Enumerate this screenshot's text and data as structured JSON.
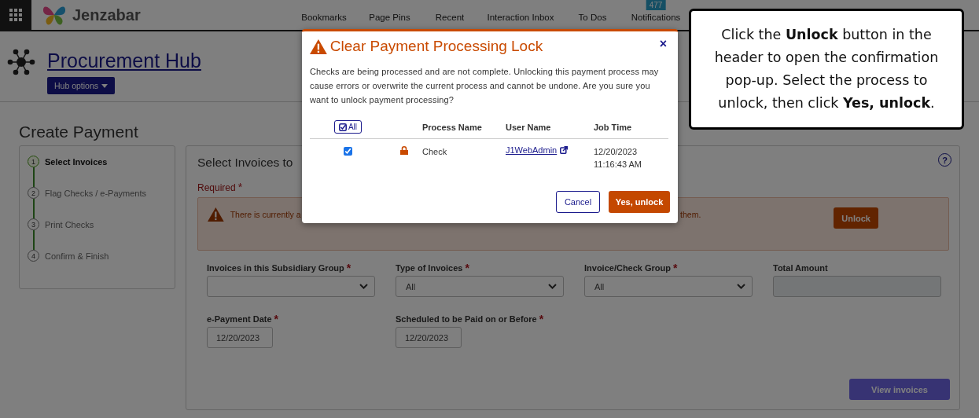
{
  "top_bar": {
    "brand": "Jenzabar",
    "nav": [
      {
        "label": "Bookmarks"
      },
      {
        "label": "Page Pins"
      },
      {
        "label": "Recent"
      },
      {
        "label": "Interaction Inbox"
      },
      {
        "label": "To Dos"
      },
      {
        "label": "Notifications",
        "badge": "477"
      }
    ]
  },
  "hub": {
    "title": "Procurement Hub",
    "options_button": "Hub options"
  },
  "page_title": "Create Payment",
  "steps": [
    {
      "number": "1",
      "label": "Select Invoices",
      "selected": true
    },
    {
      "number": "2",
      "label": "Flag Checks / e-Payments",
      "selected": false
    },
    {
      "number": "3",
      "label": "Print Checks",
      "selected": false
    },
    {
      "number": "4",
      "label": "Confirm & Finish",
      "selected": false
    }
  ],
  "panel": {
    "title": "Select Invoices to",
    "help": "?",
    "required_label": "Required",
    "required_mark": "*",
    "warning": {
      "text_start": "There is currently a",
      "text_end": "them.",
      "button": "Unlock"
    },
    "fields": [
      {
        "label": "Invoices in this Subsidiary Group",
        "required": true,
        "kind": "select"
      },
      {
        "label": "Type of Invoices",
        "required": true,
        "kind": "select",
        "value": "All"
      },
      {
        "label": "Invoice/Check Group",
        "required": true,
        "kind": "select",
        "value": "All"
      },
      {
        "label": "Total Amount",
        "required": false,
        "kind": "readonly"
      },
      {
        "label": "e-Payment Date",
        "required": true,
        "kind": "date",
        "value": "12/20/2023"
      },
      {
        "label": "Scheduled to be Paid on or Before",
        "required": true,
        "kind": "date",
        "value": "12/20/2023"
      }
    ],
    "view_button": "View invoices"
  },
  "dialog": {
    "title": "Clear Payment Processing Lock",
    "close": "×",
    "message": "Checks are being processed and are not complete. Unlocking this payment process may cause errors or overwrite the current process and cannot be undone. Are you sure you want to unlock payment processing?",
    "select_all": "All",
    "columns": [
      "Process Name",
      "User Name",
      "Job Time"
    ],
    "rows": [
      {
        "selected": true,
        "locked": true,
        "process": "Check",
        "user": "J1WebAdmin",
        "job_time": "12/20/2023 11:16:43 AM"
      }
    ],
    "buttons": [
      {
        "label": "Cancel",
        "kind": "secondary"
      },
      {
        "label": "Yes, unlock",
        "kind": "primary"
      }
    ]
  },
  "callout": {
    "text": "Click the **Unlock** button in the header to open the confirmation pop-up. Select the process to unlock, then click **Yes, unlock**."
  }
}
